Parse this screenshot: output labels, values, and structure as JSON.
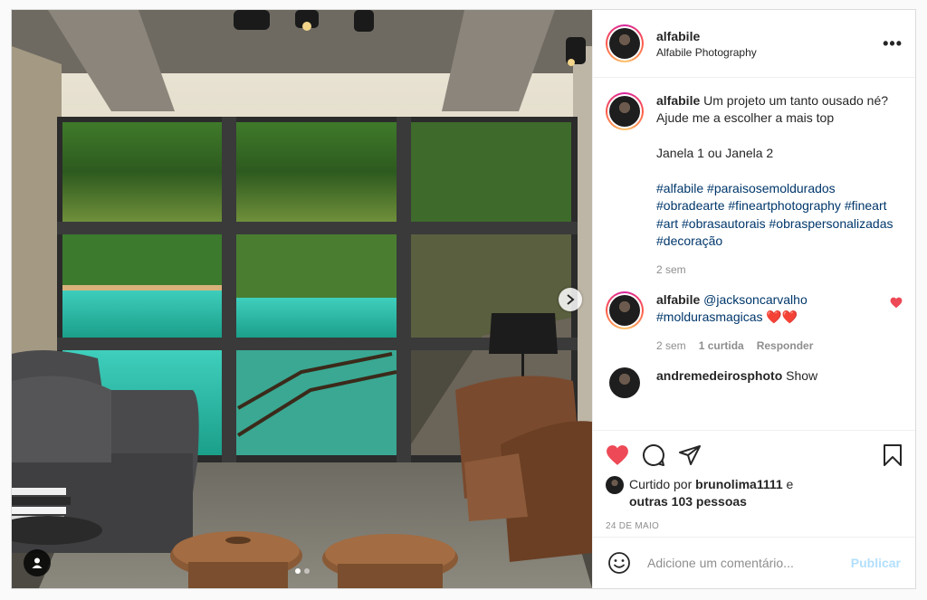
{
  "post": {
    "author": {
      "username": "alfabile",
      "subtitle": "Alfabile Photography"
    },
    "more_icon": "more-horizontal-icon",
    "caption": {
      "username": "alfabile",
      "line1": "Um projeto um tanto ousado né?",
      "line2": "Ajude me a escolher a mais top",
      "line3": "Janela 1 ou Janela 2",
      "hashtags": "#alfabile #paraisosemoldurados #obradearte #fineartphotography #fineart #art #obrasautorais #obraspersonalizadas #decoração",
      "time": "2 sem"
    },
    "comments": [
      {
        "username": "alfabile",
        "mention": "@jacksoncarvalho",
        "text": "#moldurasmagicas ❤️❤️",
        "time": "2 sem",
        "likes": "1 curtida",
        "reply": "Responder",
        "liked": true
      },
      {
        "username": "andremedeirosphoto",
        "text": "Show"
      }
    ],
    "liked_by_prefix": "Curtido por",
    "liked_by_user": "brunolima1111",
    "liked_by_and": "e",
    "liked_by_others": "outras 103 pessoas",
    "date": "24 DE MAIO",
    "add_comment_placeholder": "Adicione um comentário...",
    "publish_label": "Publicar",
    "carousel": {
      "current": 1,
      "total": 2
    }
  },
  "colors": {
    "like_red": "#ed4956",
    "link_blue": "#00376b",
    "publish_disabled": "#b2dffc"
  }
}
